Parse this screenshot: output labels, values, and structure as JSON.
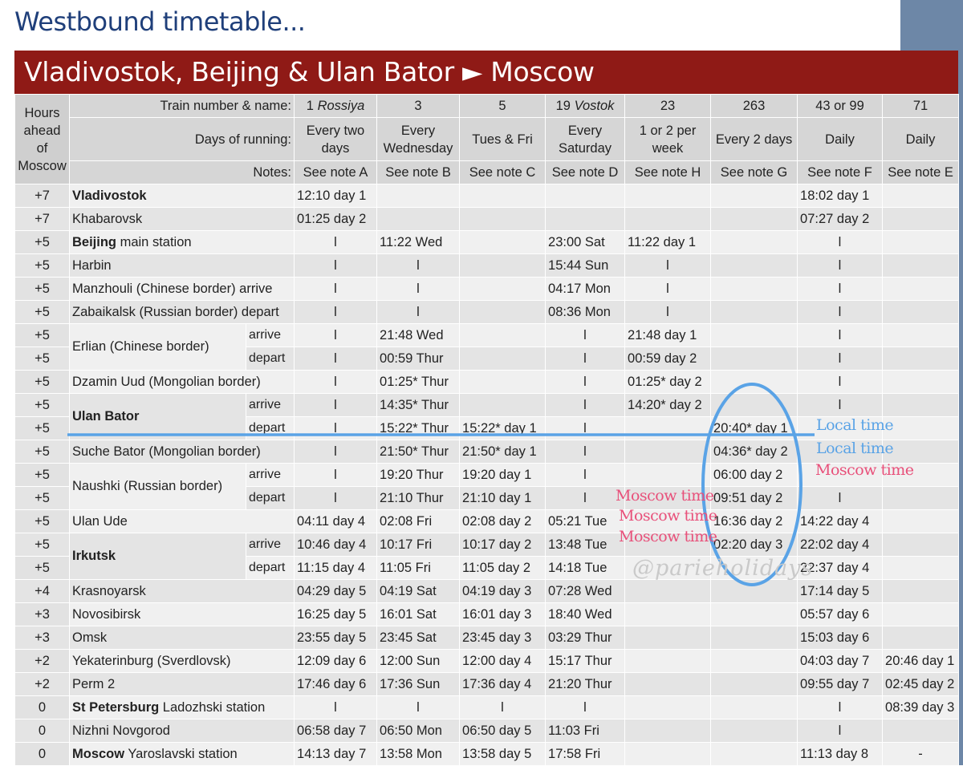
{
  "heading": "Westbound timetable...",
  "banner": "Vladivostok, Beijing & Ulan Bator ► Moscow",
  "hours_header": [
    "Hours",
    "ahead",
    "of",
    "Moscow"
  ],
  "row_labels": {
    "train": "Train number & name:",
    "days": "Days of running:",
    "notes": "Notes:"
  },
  "trains": [
    {
      "num": "1",
      "name": "Rossiya",
      "days": [
        "Every two",
        "days"
      ],
      "note": "See note A"
    },
    {
      "num": "3",
      "name": "",
      "days": [
        "Every",
        "Wednesday"
      ],
      "note": "See note B"
    },
    {
      "num": "5",
      "name": "",
      "days": [
        "Tues & Fri"
      ],
      "note": "See note C"
    },
    {
      "num": "19",
      "name": "Vostok",
      "days": [
        "Every",
        "Saturday"
      ],
      "note": "See note D"
    },
    {
      "num": "23",
      "name": "",
      "days": [
        "1 or 2 per",
        "week"
      ],
      "note": "See note H"
    },
    {
      "num": "263",
      "name": "",
      "days": [
        "Every 2 days"
      ],
      "note": "See note G"
    },
    {
      "num": "43 or 99",
      "name": "",
      "days": [
        "Daily"
      ],
      "note": "See note F"
    },
    {
      "num": "71",
      "name": "",
      "days": [
        "Daily"
      ],
      "note": "See note E"
    }
  ],
  "rows": [
    {
      "h": "+7",
      "bold": "Vladivostok",
      "rest": "",
      "sub": "",
      "t": [
        "12:10  day 1",
        "",
        "",
        "",
        "",
        "",
        "18:02  day 1",
        ""
      ]
    },
    {
      "h": "+7",
      "bold": "",
      "rest": "Khabarovsk",
      "sub": "",
      "t": [
        "01:25  day 2",
        "",
        "",
        "",
        "",
        "",
        "07:27  day 2",
        ""
      ]
    },
    {
      "h": "+5",
      "bold": "Beijing",
      "rest": " main station",
      "sub": "",
      "t": [
        "l",
        "11:22  Wed",
        "",
        "23:00  Sat",
        "11:22  day 1",
        "",
        "l",
        ""
      ]
    },
    {
      "h": "+5",
      "bold": "",
      "rest": "Harbin",
      "sub": "",
      "t": [
        "l",
        "l",
        "",
        "15:44  Sun",
        "l",
        "",
        "l",
        ""
      ]
    },
    {
      "h": "+5",
      "bold": "",
      "rest": "Manzhouli (Chinese border) arrive",
      "sub": "",
      "t": [
        "l",
        "l",
        "",
        "04:17  Mon",
        "l",
        "",
        "l",
        ""
      ]
    },
    {
      "h": "+5",
      "bold": "",
      "rest": "Zabaikalsk (Russian border) depart",
      "sub": "",
      "t": [
        "l",
        "l",
        "",
        "08:36  Mon",
        "l",
        "",
        "l",
        ""
      ]
    },
    {
      "h": "+5",
      "bold": "",
      "rest": "Erlian  (Chinese border)",
      "sub": "arrive",
      "t": [
        "l",
        "21:48  Wed",
        "",
        "l",
        "21:48  day 1",
        "",
        "l",
        ""
      ]
    },
    {
      "h": "+5",
      "bold": "",
      "rest": "",
      "sub": "depart",
      "t": [
        "l",
        "00:59  Thur",
        "",
        "l",
        "00:59  day 2",
        "",
        "l",
        ""
      ]
    },
    {
      "h": "+5",
      "bold": "",
      "rest": "Dzamin Uud (Mongolian border)",
      "sub": "",
      "t": [
        "l",
        "01:25* Thur",
        "",
        "l",
        "01:25* day 2",
        "",
        "l",
        ""
      ]
    },
    {
      "h": "+5",
      "bold": "Ulan Bator",
      "rest": "",
      "sub": "arrive",
      "t": [
        "l",
        "14:35* Thur",
        "",
        "l",
        "14:20* day 2",
        "",
        "l",
        ""
      ]
    },
    {
      "h": "+5",
      "bold": "",
      "rest": "",
      "sub": "depart",
      "t": [
        "l",
        "15:22* Thur",
        "15:22* day 1",
        "l",
        "",
        "20:40* day 1",
        "",
        ""
      ]
    },
    {
      "h": "+5",
      "bold": "",
      "rest": "Suche Bator (Mongolian border)",
      "sub": "",
      "t": [
        "l",
        "21:50* Thur",
        "21:50* day 1",
        "l",
        "",
        "04:36* day 2",
        "",
        ""
      ]
    },
    {
      "h": "+5",
      "bold": "",
      "rest": "Naushki (Russian border)",
      "sub": "arrive",
      "t": [
        "l",
        "19:20  Thur",
        "19:20  day 1",
        "l",
        "",
        "06:00   day 2",
        "",
        ""
      ]
    },
    {
      "h": "+5",
      "bold": "",
      "rest": "",
      "sub": "depart",
      "t": [
        "l",
        "21:10  Thur",
        "21:10  day 1",
        "l",
        "",
        "09:51  day 2",
        "l",
        ""
      ]
    },
    {
      "h": "+5",
      "bold": "",
      "rest": "Ulan Ude",
      "sub": "",
      "t": [
        "04:11  day 4",
        "02:08  Fri",
        "02:08  day 2",
        "05:21  Tue",
        "",
        "16:36  day 2",
        "14:22  day 4",
        ""
      ]
    },
    {
      "h": "+5",
      "bold": "Irkutsk",
      "rest": "",
      "sub": "arrive",
      "t": [
        "10:46  day 4",
        "10:17  Fri",
        "10:17  day 2",
        "13:48  Tue",
        "",
        "02:20  day 3",
        "22:02  day 4",
        ""
      ]
    },
    {
      "h": "+5",
      "bold": "",
      "rest": "",
      "sub": "depart",
      "t": [
        "11:15  day 4",
        "11:05  Fri",
        "11:05  day 2",
        "14:18  Tue",
        "",
        "",
        "22:37  day 4",
        ""
      ]
    },
    {
      "h": "+4",
      "bold": "",
      "rest": "Krasnoyarsk",
      "sub": "",
      "t": [
        "04:29  day 5",
        "04:19  Sat",
        "04:19  day 3",
        "07:28  Wed",
        "",
        "",
        "17:14  day 5",
        ""
      ]
    },
    {
      "h": "+3",
      "bold": "",
      "rest": "Novosibirsk",
      "sub": "",
      "t": [
        "16:25  day 5",
        "16:01  Sat",
        "16:01  day 3",
        "18:40  Wed",
        "",
        "",
        "05:57  day 6",
        ""
      ]
    },
    {
      "h": "+3",
      "bold": "",
      "rest": "Omsk",
      "sub": "",
      "t": [
        "23:55  day 5",
        "23:45  Sat",
        "23:45  day 3",
        "03:29  Thur",
        "",
        "",
        "15:03  day 6",
        ""
      ]
    },
    {
      "h": "+2",
      "bold": "",
      "rest": "Yekaterinburg (Sverdlovsk)",
      "sub": "",
      "t": [
        "12:09  day 6",
        "12:00  Sun",
        "12:00  day 4",
        "15:17  Thur",
        "",
        "",
        "04:03  day 7",
        "20:46 day 1"
      ]
    },
    {
      "h": "+2",
      "bold": "",
      "rest": "Perm 2",
      "sub": "",
      "t": [
        "17:46  day 6",
        "17:36  Sun",
        "17:36  day 4",
        "21:20  Thur",
        "",
        "",
        "09:55  day 7",
        "02:45 day 2"
      ]
    },
    {
      "h": "0",
      "bold": "St Petersburg",
      "rest": " Ladozhski station",
      "sub": "",
      "t": [
        "l",
        "l",
        "l",
        "l",
        "",
        "",
        "l",
        "08:39 day 3"
      ]
    },
    {
      "h": "0",
      "bold": "",
      "rest": "Nizhni Novgorod",
      "sub": "",
      "t": [
        "06:58  day 7",
        "06:50  Mon",
        "06:50  day 5",
        "11:03  Fri",
        "",
        "",
        "l",
        ""
      ]
    },
    {
      "h": "0",
      "bold": "Moscow",
      "rest": " Yaroslavski station",
      "sub": "",
      "t": [
        "14:13  day 7",
        "13:58  Mon",
        "13:58  day 5",
        "17:58  Fri",
        "",
        "",
        "11:13  day 8",
        "-"
      ]
    }
  ],
  "annotations": {
    "local_1": "Local time",
    "local_2": "Local time",
    "moscow_right": "Moscow time",
    "moscow_1": "Moscow time",
    "moscow_2": "Moscow time",
    "moscow_3": "Moscow time",
    "watermark": "@parieholidays"
  },
  "colors": {
    "banner": "#8f1a16",
    "heading": "#1f3f7a",
    "annotation_blue": "#5aa3e6",
    "annotation_pink": "#e8507a",
    "side_bar": "#6d87a7"
  }
}
